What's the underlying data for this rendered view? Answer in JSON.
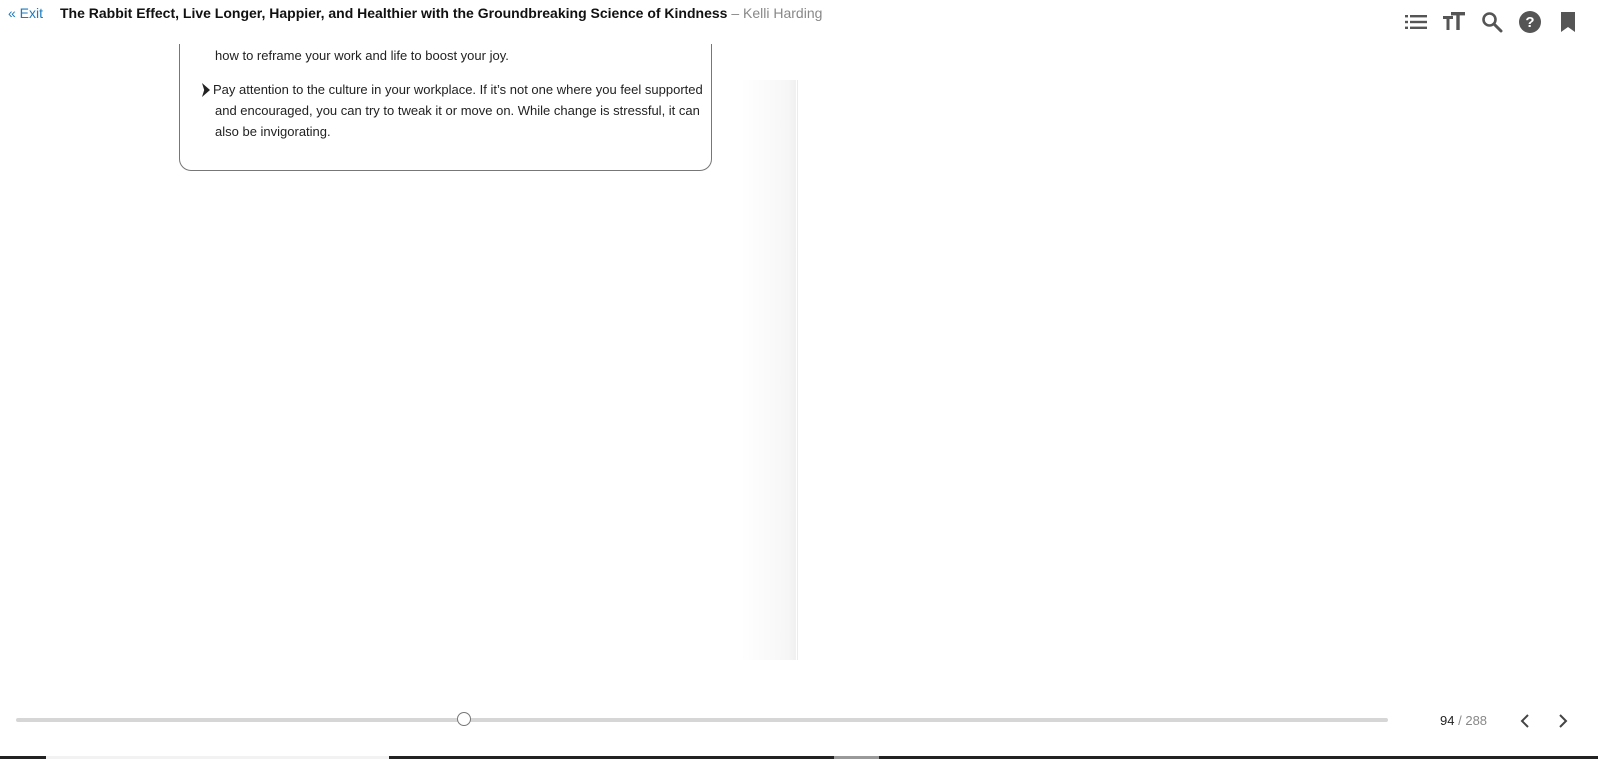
{
  "header": {
    "exit_label": "« Exit",
    "title": "The Rabbit Effect, Live Longer, Happier, and Healthier with the Groundbreaking Science of Kindness",
    "separator": "–",
    "author": "Kelli Harding"
  },
  "toolbar": {
    "icons": [
      "table-of-contents-icon",
      "text-size-icon",
      "search-icon",
      "help-icon",
      "bookmark-icon"
    ]
  },
  "content": {
    "fragment_line": "how to reframe your work and life to boost your joy.",
    "bullet_lines": [
      "Pay attention to the culture in your workplace. If it’s not one where you feel supported",
      "and encouraged, you can try to tweak it or move on. While change is stressful, it can",
      "also be invigorating."
    ]
  },
  "navigation": {
    "current_page": "94",
    "separator": "/",
    "total_pages": "288",
    "progress_fraction": 0.3264
  },
  "colors": {
    "link": "#1a7bbf",
    "icon": "#555555",
    "muted": "#888888"
  }
}
